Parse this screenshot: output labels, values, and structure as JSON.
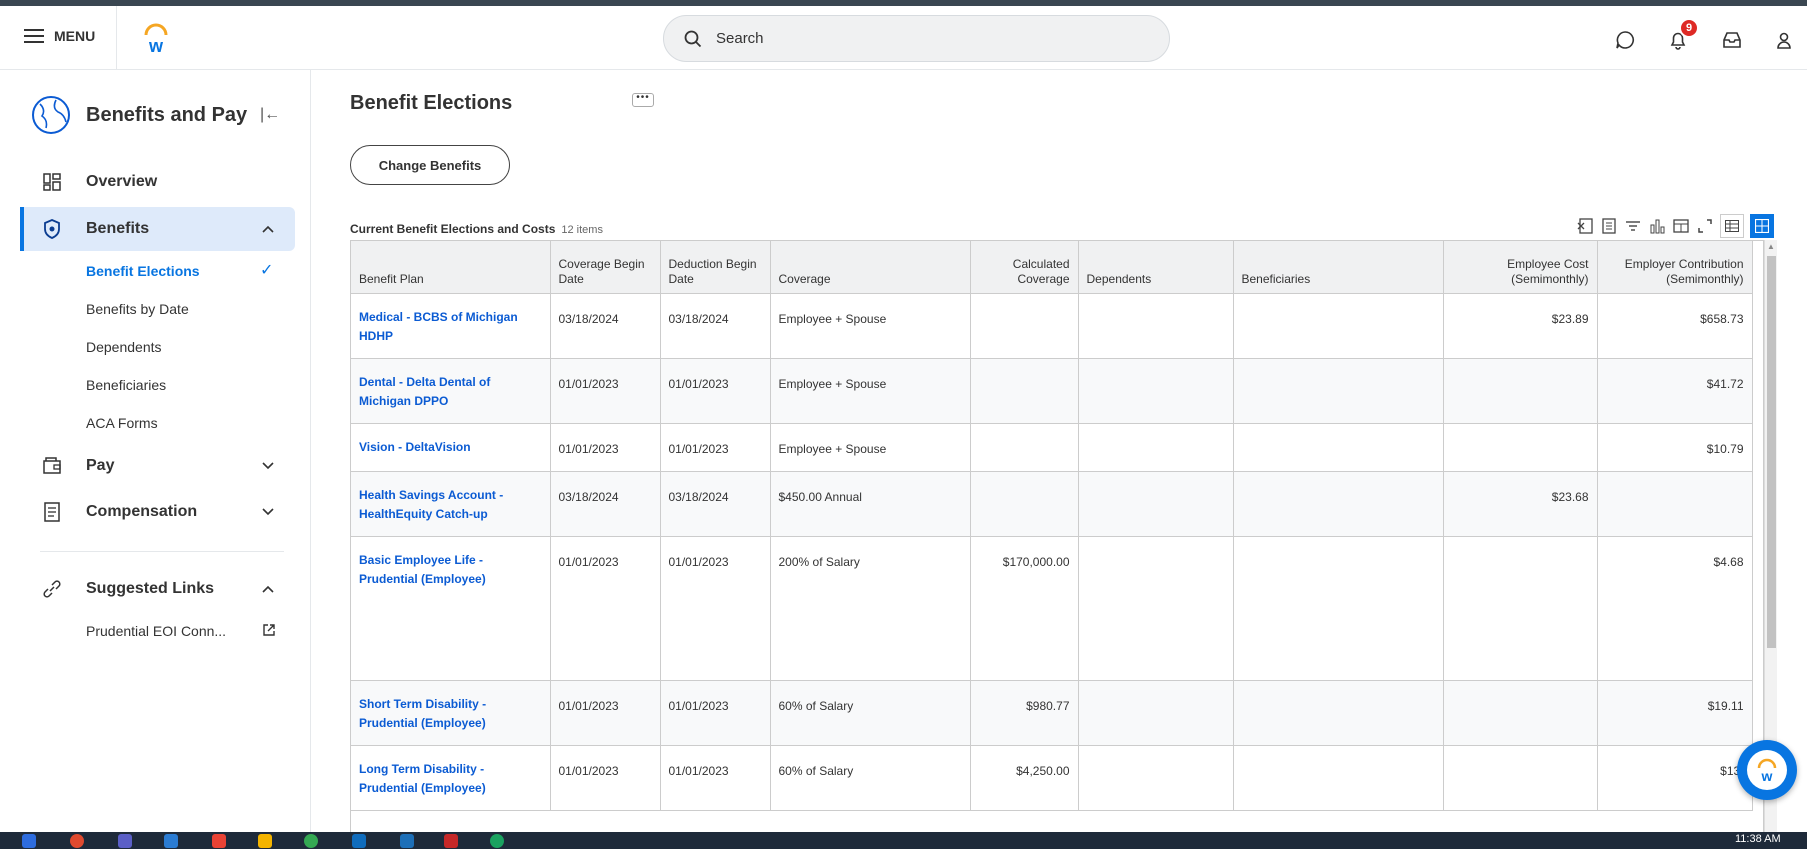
{
  "header": {
    "menu_label": "MENU",
    "search_placeholder": "Search",
    "notification_count": "9"
  },
  "sidebar": {
    "title": "Benefits and Pay",
    "items": [
      {
        "label": "Overview"
      },
      {
        "label": "Benefits"
      },
      {
        "label": "Pay"
      },
      {
        "label": "Compensation"
      }
    ],
    "benefits_subitems": [
      {
        "label": "Benefit Elections"
      },
      {
        "label": "Benefits by Date"
      },
      {
        "label": "Dependents"
      },
      {
        "label": "Beneficiaries"
      },
      {
        "label": "ACA Forms"
      }
    ],
    "suggested_links_label": "Suggested Links",
    "suggested_links": [
      {
        "label": "Prudential EOI Conn..."
      }
    ]
  },
  "main": {
    "title": "Benefit Elections",
    "related_actions": "•••",
    "change_benefits_label": "Change Benefits",
    "grid_title": "Current Benefit Elections and Costs",
    "grid_count": "12 items",
    "columns": [
      "Benefit Plan",
      "Coverage Begin Date",
      "Deduction Begin Date",
      "Coverage",
      "Calculated Coverage",
      "Dependents",
      "Beneficiaries",
      "Employee Cost (Semimonthly)",
      "Employer Contribution (Semimonthly)"
    ],
    "rows": [
      {
        "plan": "Medical - BCBS of Michigan HDHP",
        "cov_begin": "03/18/2024",
        "ded_begin": "03/18/2024",
        "coverage": "Employee + Spouse",
        "calc": "",
        "dependents": "",
        "beneficiaries": "",
        "emp_cost": "$23.89",
        "employer": "$658.73"
      },
      {
        "plan": "Dental - Delta Dental of Michigan DPPO",
        "cov_begin": "01/01/2023",
        "ded_begin": "01/01/2023",
        "coverage": "Employee + Spouse",
        "calc": "",
        "dependents": "",
        "beneficiaries": "",
        "emp_cost": "",
        "employer": "$41.72"
      },
      {
        "plan": "Vision - DeltaVision",
        "cov_begin": "01/01/2023",
        "ded_begin": "01/01/2023",
        "coverage": "Employee + Spouse",
        "calc": "",
        "dependents": "",
        "beneficiaries": "",
        "emp_cost": "",
        "employer": "$10.79"
      },
      {
        "plan": "Health Savings Account - HealthEquity Catch-up",
        "cov_begin": "03/18/2024",
        "ded_begin": "03/18/2024",
        "coverage": "$450.00 Annual",
        "calc": "",
        "dependents": "",
        "beneficiaries": "",
        "emp_cost": "$23.68",
        "employer": ""
      },
      {
        "plan": "Basic Employee Life - Prudential (Employee)",
        "cov_begin": "01/01/2023",
        "ded_begin": "01/01/2023",
        "coverage": "200% of Salary",
        "calc": "$170,000.00",
        "dependents": "",
        "beneficiaries": "",
        "emp_cost": "",
        "employer": "$4.68"
      },
      {
        "plan": "Short Term Disability - Prudential (Employee)",
        "cov_begin": "01/01/2023",
        "ded_begin": "01/01/2023",
        "coverage": "60% of Salary",
        "calc": "$980.77",
        "dependents": "",
        "beneficiaries": "",
        "emp_cost": "",
        "employer": "$19.11"
      },
      {
        "plan": "Long Term Disability - Prudential (Employee)",
        "cov_begin": "01/01/2023",
        "ded_begin": "01/01/2023",
        "coverage": "60% of Salary",
        "calc": "$4,250.00",
        "dependents": "",
        "beneficiaries": "",
        "emp_cost": "",
        "employer": "$13."
      }
    ]
  },
  "taskbar": {
    "clock": "11:38 AM"
  },
  "colors": {
    "accent": "#0875e1",
    "link": "#0b5bd3",
    "badge": "#de2a25"
  }
}
